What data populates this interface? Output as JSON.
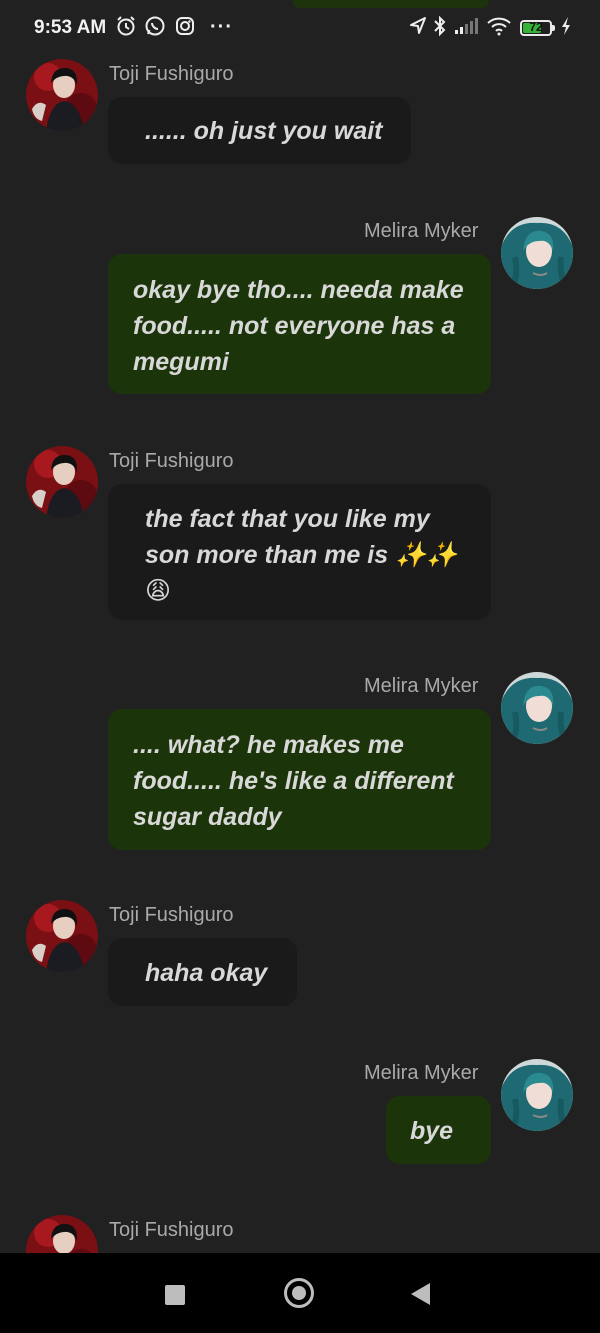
{
  "status_bar": {
    "time": "9:53 AM",
    "icons": [
      "alarm-icon",
      "whatsapp-icon",
      "instagram-icon",
      "more-icon",
      "location-icon",
      "bluetooth-icon",
      "signal-icon",
      "wifi-icon",
      "battery-icon",
      "charging-icon"
    ],
    "more_glyph": "···",
    "battery_level": "72",
    "battery_color": "#35b335"
  },
  "colors": {
    "background": "#212121",
    "incoming_bubble": "#1a1a1a",
    "outgoing_bubble": "#1c3409",
    "name_text": "#a9a9a9",
    "message_text": "#d8d8d8"
  },
  "messages": [
    {
      "sender": "Toji Fushiguro",
      "direction": "incoming",
      "text": "...... oh just you wait"
    },
    {
      "sender": "Melira Myker",
      "direction": "outgoing",
      "text": "okay bye tho.... needa make food..... not everyone has a megumi"
    },
    {
      "sender": "Toji Fushiguro",
      "direction": "incoming",
      "text": "the fact that you like my son more than me is ✨✨😩"
    },
    {
      "sender": "Melira Myker",
      "direction": "outgoing",
      "text": ".... what? he makes me food.....  he's like a different sugar daddy"
    },
    {
      "sender": "Toji Fushiguro",
      "direction": "incoming",
      "text": "haha okay"
    },
    {
      "sender": "Melira Myker",
      "direction": "outgoing",
      "text": "bye"
    },
    {
      "sender": "Toji Fushiguro",
      "direction": "incoming",
      "text": ""
    }
  ],
  "nav_bar": {
    "buttons": [
      "recents-button",
      "home-button",
      "back-button"
    ]
  }
}
